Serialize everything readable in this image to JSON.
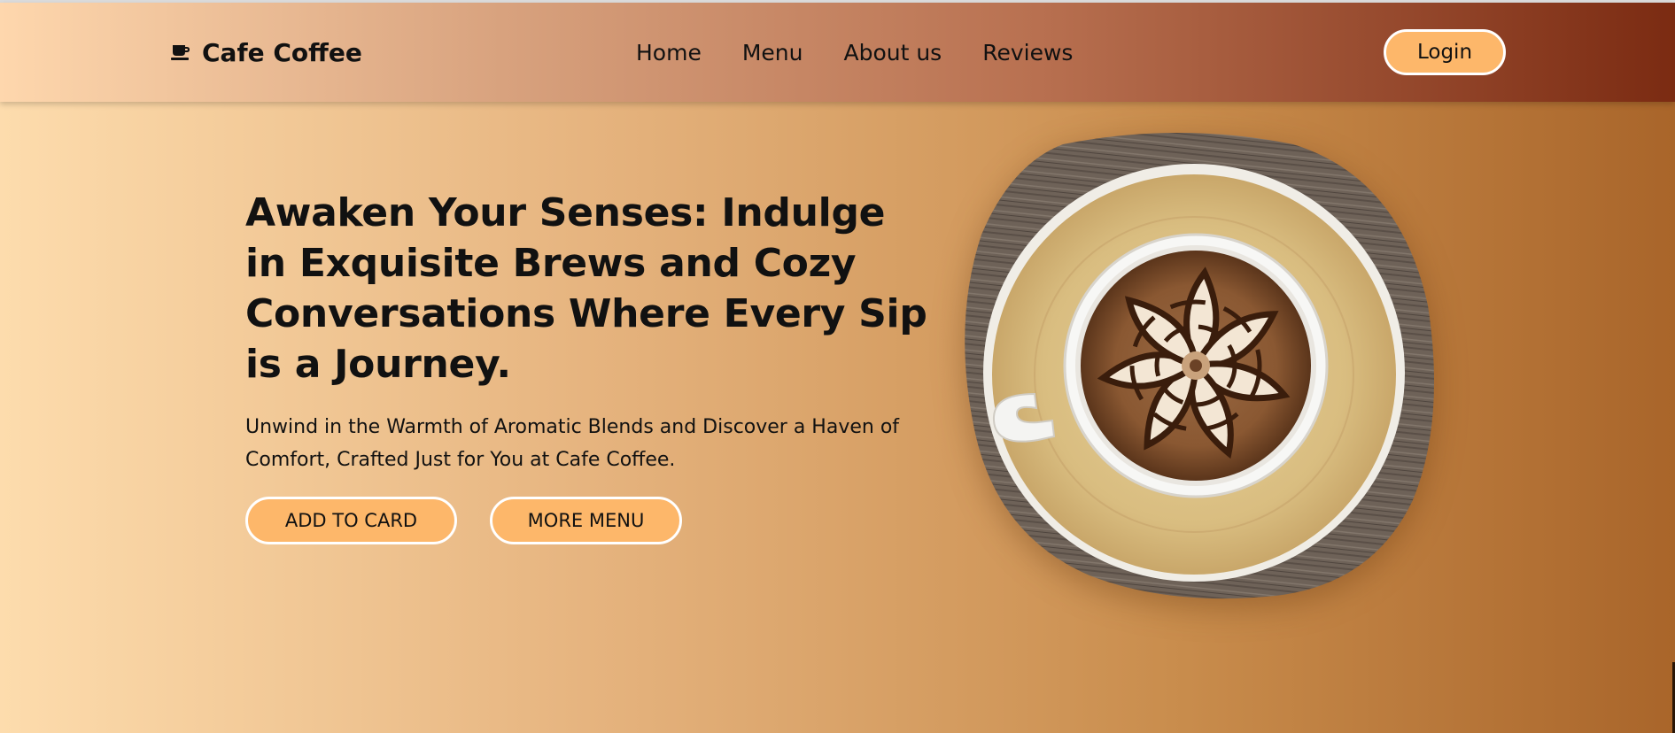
{
  "navbar": {
    "brand": {
      "icon": "coffee-cup-icon",
      "name": "Cafe Coffee"
    },
    "links": [
      {
        "label": "Home"
      },
      {
        "label": "Menu"
      },
      {
        "label": "About us"
      },
      {
        "label": "Reviews"
      }
    ],
    "login_label": "Login"
  },
  "hero": {
    "title": "Awaken Your Senses: Indulge in Exquisite Brews and Cozy Conversations Where Every Sip is a Journey.",
    "subtitle": "Unwind in the Warmth of Aromatic Blends and Discover a Haven of Comfort, Crafted Just for You at Cafe Coffee.",
    "buttons": {
      "add_to_card": "ADD TO CARD",
      "more_menu": "MORE MENU"
    },
    "image": "latte-art-coffee-cup-on-saucer"
  },
  "colors": {
    "button_fill": "#fdb76a",
    "button_border": "#ffffff",
    "navbar_start": "#fed7ad",
    "navbar_end": "#7b2b12",
    "page_start": "#fddcad",
    "page_end": "#a9652a"
  }
}
